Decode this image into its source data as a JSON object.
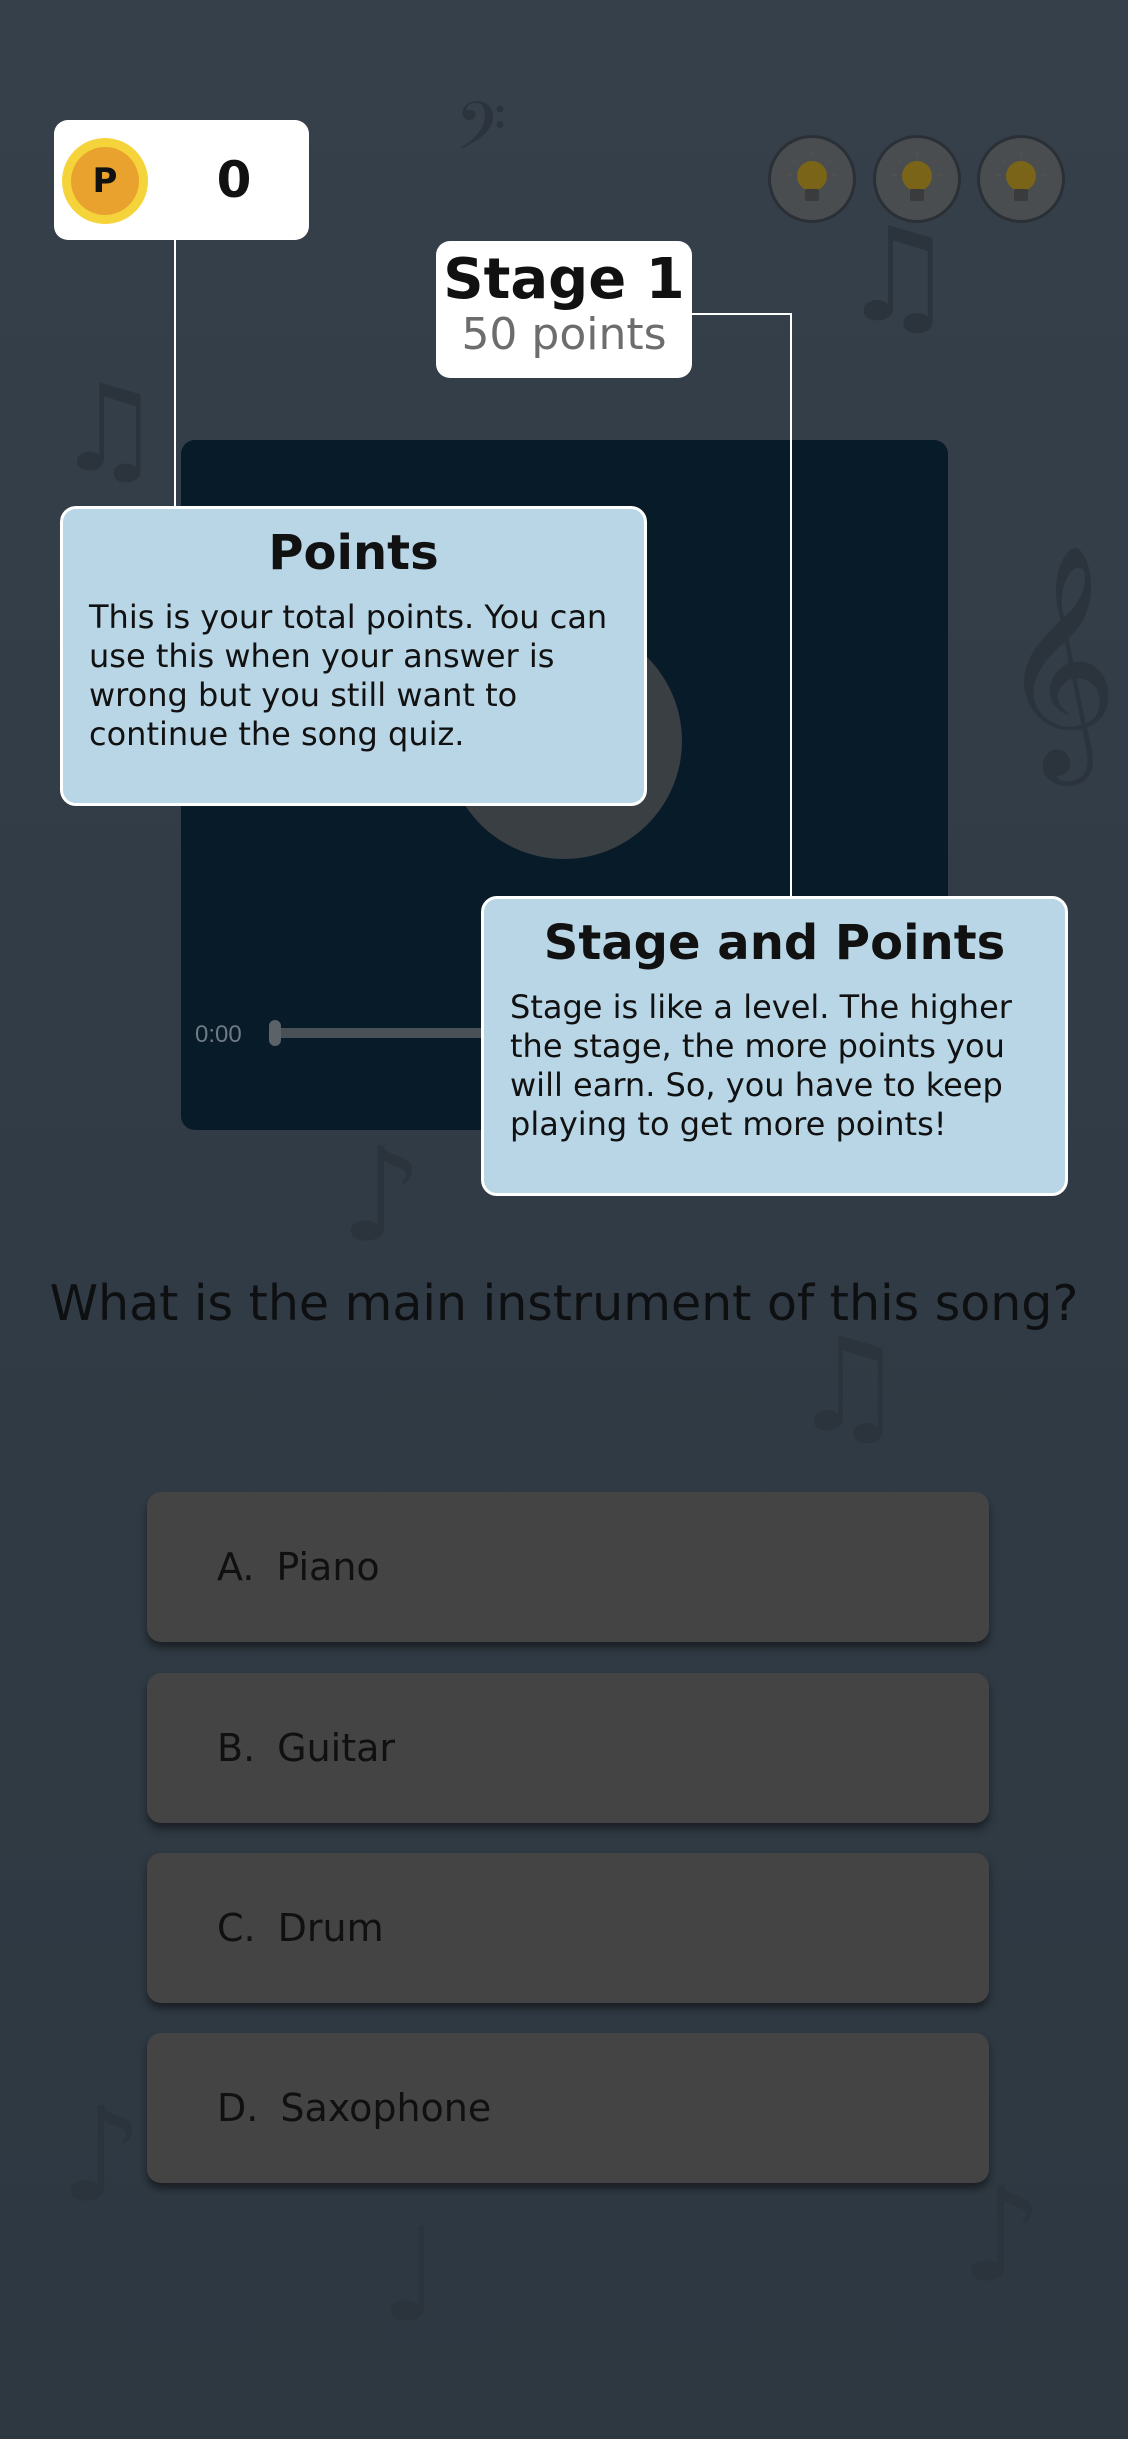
{
  "header": {
    "coin_symbol": "P",
    "points": "0",
    "hints": [
      {
        "icon": "lightbulb-icon"
      },
      {
        "icon": "lightbulb-icon"
      },
      {
        "icon": "lightbulb-icon"
      }
    ]
  },
  "stage": {
    "title": "Stage 1",
    "points": "50 points"
  },
  "player": {
    "time": "0:00",
    "progress": 0
  },
  "tooltips": {
    "points": {
      "title": "Points",
      "body": "This is your total points. You can use this when your answer is wrong but you still want to continue the song quiz."
    },
    "stage": {
      "title": "Stage and Points",
      "body": "Stage is like a level. The higher the stage, the more points you will earn. So, you have to keep playing to get more points!"
    }
  },
  "quiz": {
    "question": "What is the main instrument of this song?",
    "answers": [
      {
        "letter": "A.",
        "label": "Piano"
      },
      {
        "letter": "B.",
        "label": "Guitar"
      },
      {
        "letter": "C.",
        "label": "Drum"
      },
      {
        "letter": "D.",
        "label": "Saxophone"
      }
    ]
  },
  "colors": {
    "overlay_background": "#333d47",
    "tooltip_background": "#b9d6e7",
    "coin_ring": "#f5d33a",
    "coin_fill": "#e9a22d",
    "player_background": "#071b28"
  }
}
